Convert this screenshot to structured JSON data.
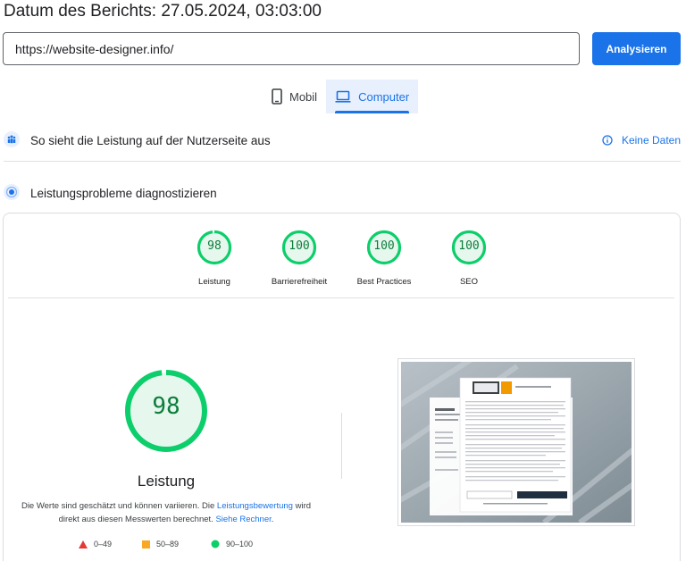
{
  "header": {
    "report_date": "Datum des Berichts: 27.05.2024, 03:03:00"
  },
  "url_bar": {
    "value": "https://website-designer.info/",
    "analyze_label": "Analysieren"
  },
  "device_tabs": [
    {
      "label": "Mobil",
      "icon": "smartphone-icon",
      "active": false
    },
    {
      "label": "Computer",
      "icon": "laptop-icon",
      "active": true
    }
  ],
  "field_data": {
    "title": "So sieht die Leistung auf der Nutzerseite aus",
    "no_data_label": "Keine Daten"
  },
  "diagnose": {
    "title": "Leistungsprobleme diagnostizieren"
  },
  "scores": [
    {
      "label": "Leistung",
      "value": "98"
    },
    {
      "label": "Barrierefreiheit",
      "value": "100"
    },
    {
      "label": "Best Practices",
      "value": "100"
    },
    {
      "label": "SEO",
      "value": "100"
    }
  ],
  "performance": {
    "score": "98",
    "fraction": 0.98,
    "title": "Leistung",
    "disclaimer_pre": "Die Werte sind geschätzt und können variieren. Die ",
    "disclaimer_link1": "Leistungsbewertung",
    "disclaimer_mid": " wird direkt aus diesen Messwerten berechnet. ",
    "disclaimer_link2": "Siehe Rechner",
    "disclaimer_post": "."
  },
  "legend": [
    {
      "range": "0–49",
      "shape": "triangle",
      "color": "#e53935"
    },
    {
      "range": "50–89",
      "shape": "square",
      "color": "#f9a825"
    },
    {
      "range": "90–100",
      "shape": "circle",
      "color": "#0cce6b"
    }
  ],
  "colors": {
    "accent": "#1a73e8",
    "pass": "#0cce6b",
    "pass_text": "#0c7d3a",
    "pass_bg": "#e6f7ee"
  }
}
